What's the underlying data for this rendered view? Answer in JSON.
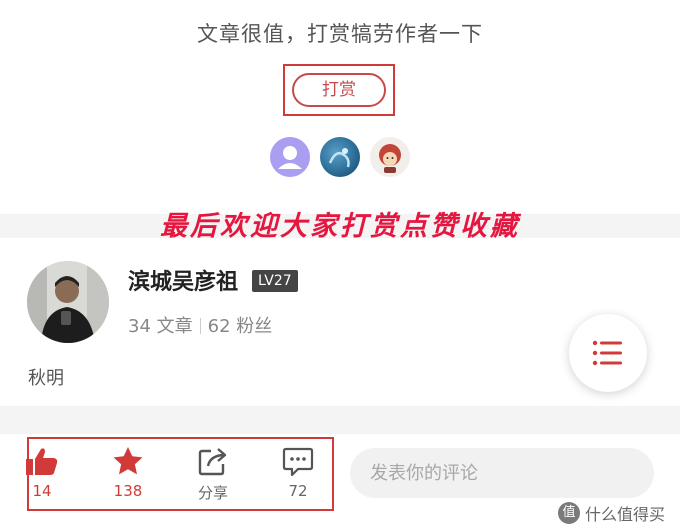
{
  "tip": {
    "prompt": "文章很值，打赏犒劳作者一下",
    "button_label": "打赏"
  },
  "banner": {
    "text": "最后欢迎大家打赏点赞收藏"
  },
  "author": {
    "name": "滨城吴彦祖",
    "level": "LV27",
    "articles_count": "34",
    "articles_label": "文章",
    "fans_count": "62",
    "fans_label": "粉丝",
    "description": "秋明"
  },
  "actions": {
    "like_count": "14",
    "favorite_count": "138",
    "share_label": "分享",
    "comment_count": "72"
  },
  "comment": {
    "placeholder": "发表你的评论"
  },
  "watermark": {
    "logo": "值",
    "text": "什么值得买"
  },
  "colors": {
    "accent": "#d23a3a",
    "banner": "#e5163f",
    "separator": "#f4f4f4"
  }
}
